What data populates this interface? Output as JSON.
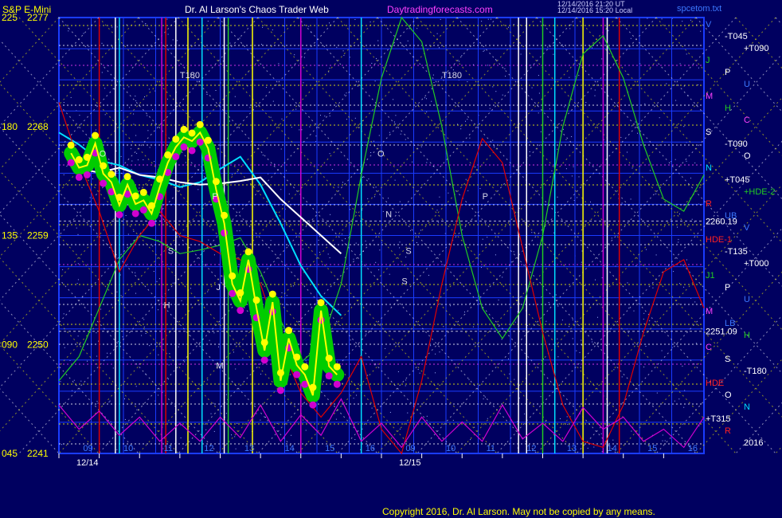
{
  "header": {
    "title_left": "S&P E-Mini",
    "title_center": "Dr. Al Larson's Chaos Trader Web",
    "site": "Daytradingforecasts.com",
    "info_line1": "12/14/2016 21:20 UT",
    "info_line2": "12/14/2016 15:20 Local",
    "file": "spcetom.txt"
  },
  "copyright": "Copyright 2016, Dr. Al Larson. May not be copied by any means.",
  "colors": {
    "background": "#000060",
    "grid_blue": "#1a3cff",
    "yellow": "#ffff00",
    "green_band": "#00cc00",
    "magenta": "#d000d0",
    "cyan": "#00e0ff",
    "white": "#ffffff",
    "red": "#e00000",
    "green_line": "#22cc22"
  },
  "chart_data": {
    "type": "line",
    "y_axis_labels": [
      {
        "angle": "225",
        "price": 2277
      },
      {
        "angle": "180",
        "price": 2268
      },
      {
        "angle": "135",
        "price": 2259
      },
      {
        "angle": "090",
        "price": 2250
      },
      {
        "angle": "045",
        "price": 2241
      }
    ],
    "ylim": [
      2241,
      2277
    ],
    "x_hours": [
      "09",
      "10",
      "11",
      "12",
      "13",
      "14",
      "15",
      "16",
      "09",
      "10",
      "11",
      "12",
      "13",
      "14",
      "15",
      "16"
    ],
    "x_dates": [
      "12/14",
      "12/15"
    ],
    "price_levels": [
      {
        "label": "2260.19",
        "price": 2260.19
      },
      {
        "label": "2251.09",
        "price": 2251.09
      }
    ],
    "right_labels": [
      {
        "text": "V",
        "color": "#3c78ff"
      },
      {
        "text": "-T045",
        "color": "#ffffff"
      },
      {
        "text": "+T090",
        "color": "#ffffff"
      },
      {
        "text": "J",
        "color": "#22cc22"
      },
      {
        "text": "P",
        "color": "#ffffff"
      },
      {
        "text": "U",
        "color": "#3c78ff"
      },
      {
        "text": "M",
        "color": "#ff40ff"
      },
      {
        "text": "H",
        "color": "#22cc22"
      },
      {
        "text": "C",
        "color": "#ff40ff"
      },
      {
        "text": "S",
        "color": "#ffffff"
      },
      {
        "text": "-T090",
        "color": "#ffffff"
      },
      {
        "text": "O",
        "color": "#ffffff"
      },
      {
        "text": "N",
        "color": "#00e0ff"
      },
      {
        "text": "+T045",
        "color": "#ffffff"
      },
      {
        "text": "+HDE-2",
        "color": "#22cc22"
      },
      {
        "text": "R",
        "color": "#ff2020"
      },
      {
        "text": "UB",
        "color": "#3c78ff"
      },
      {
        "text": "V",
        "color": "#3c78ff"
      },
      {
        "text": "HDE-1",
        "color": "#ff2020"
      },
      {
        "text": "-T135",
        "color": "#ffffff"
      },
      {
        "text": "+T000",
        "color": "#ffffff"
      },
      {
        "text": "J1",
        "color": "#22cc22"
      },
      {
        "text": "P",
        "color": "#ffffff"
      },
      {
        "text": "U",
        "color": "#3c78ff"
      },
      {
        "text": "M",
        "color": "#ff40ff"
      },
      {
        "text": "LB",
        "color": "#3c78ff"
      },
      {
        "text": "H",
        "color": "#22cc22"
      },
      {
        "text": "C",
        "color": "#ff40ff"
      },
      {
        "text": "S",
        "color": "#ffffff"
      },
      {
        "text": "-T180",
        "color": "#ffffff"
      },
      {
        "text": "HDE",
        "color": "#ff2020"
      },
      {
        "text": "O",
        "color": "#ffffff"
      },
      {
        "text": "N",
        "color": "#00e0ff"
      },
      {
        "text": "+T315",
        "color": "#ffffff"
      },
      {
        "text": "R",
        "color": "#ff2020"
      },
      {
        "text": "2016",
        "color": "#ffffff"
      }
    ],
    "chart_labels": [
      "T180",
      "T180",
      "O",
      "P",
      "S",
      "O",
      "N",
      "S",
      "P",
      "H",
      "J",
      "S",
      "M"
    ],
    "series": [
      {
        "name": "price",
        "color": "#ffff00",
        "x": [
          0.3,
          0.5,
          0.7,
          0.9,
          1.1,
          1.3,
          1.5,
          1.7,
          1.9,
          2.1,
          2.3,
          2.5,
          2.7,
          2.9,
          3.1,
          3.3,
          3.5,
          3.7,
          3.9,
          4.1,
          4.3,
          4.5,
          4.7,
          4.9,
          5.1,
          5.3,
          5.5,
          5.7,
          5.9,
          6.1,
          6.3,
          6.5,
          6.7,
          6.9
        ],
        "y": [
          2265.8,
          2264.6,
          2264.8,
          2266.6,
          2264.1,
          2263.4,
          2261.5,
          2263.2,
          2261.6,
          2261.9,
          2260.8,
          2263.0,
          2265.0,
          2266.3,
          2267.1,
          2266.8,
          2267.5,
          2266.2,
          2262.8,
          2260.0,
          2255.0,
          2253.6,
          2257.0,
          2253.0,
          2249.5,
          2253.5,
          2247.0,
          2250.5,
          2248.3,
          2247.5,
          2245.8,
          2252.8,
          2248.2,
          2247.5
        ]
      },
      {
        "name": "cyan",
        "color": "#00e0ff",
        "x": [
          0.0,
          0.5,
          1.0,
          1.5,
          2.0,
          2.5,
          3.0,
          3.5,
          4.0,
          4.5,
          5.0,
          5.5,
          6.0,
          6.5,
          7.0
        ],
        "y": [
          2267.5,
          2266.5,
          2265.2,
          2264.8,
          2264.0,
          2263.6,
          2263.0,
          2263.4,
          2264.5,
          2265.5,
          2263.2,
          2260.0,
          2256.5,
          2254.0,
          2252.4
        ]
      },
      {
        "name": "white",
        "color": "#ffffff",
        "x": [
          0.5,
          1.0,
          1.5,
          2.0,
          2.5,
          3.0,
          3.5,
          4.0,
          4.5,
          5.0,
          5.5,
          6.0,
          6.5,
          7.0
        ],
        "y": [
          2264.5,
          2264.2,
          2264.6,
          2264.0,
          2263.8,
          2263.4,
          2263.2,
          2263.3,
          2263.5,
          2263.8,
          2262.0,
          2260.5,
          2259.0,
          2257.5
        ]
      },
      {
        "name": "green",
        "color": "#22cc22",
        "x": [
          0.0,
          0.5,
          1.0,
          1.5,
          2.0,
          2.5,
          3.0,
          3.5,
          4.0,
          4.5,
          5.0,
          5.5,
          6.0,
          6.5,
          7.0,
          7.5,
          8.0,
          8.5,
          9.0,
          9.5,
          10.0,
          10.5,
          11.0,
          11.5,
          12.0,
          12.5,
          13.0,
          13.5,
          14.0,
          14.5,
          15.0,
          15.5,
          16.0
        ],
        "y": [
          2247,
          2249,
          2253,
          2257,
          2259,
          2258.5,
          2257.5,
          2257.8,
          2258.2,
          2258.8,
          2256,
          2252,
          2248.5,
          2250,
          2255,
          2264,
          2272,
          2277,
          2275,
          2268,
          2259,
          2253,
          2250.5,
          2253,
          2259,
          2268,
          2274,
          2275.5,
          2272,
          2266.5,
          2262,
          2261,
          2264
        ]
      },
      {
        "name": "red",
        "color": "#e00000",
        "x": [
          0.0,
          0.5,
          1.0,
          1.5,
          2.0,
          2.5,
          3.0,
          3.5,
          4.0,
          4.5,
          5.0,
          5.5,
          6.0,
          6.5,
          7.0,
          7.5,
          8.0,
          8.5,
          9.0,
          9.5,
          10.0,
          10.5,
          11.0,
          11.5,
          12.0,
          12.5,
          13.0,
          13.5,
          14.0,
          14.5,
          15.0,
          15.5,
          16.0
        ],
        "y": [
          2270,
          2265,
          2261,
          2256,
          2259,
          2261,
          2259,
          2258.5,
          2257.5,
          2257,
          2255,
          2250,
          2246,
          2244,
          2246,
          2249,
          2243,
          2241,
          2247,
          2255,
          2262,
          2267,
          2265,
          2258,
          2251,
          2245,
          2242,
          2241.5,
          2245,
          2251,
          2256,
          2257,
          2253
        ]
      },
      {
        "name": "magenta",
        "color": "#d000d0",
        "x": [
          0.0,
          0.5,
          1.0,
          1.5,
          2.0,
          2.5,
          3.0,
          3.5,
          4.0,
          4.5,
          5.0,
          5.5,
          6.0,
          6.5,
          7.0,
          7.5,
          8.0,
          8.5,
          9.0,
          9.5,
          10.0,
          10.5,
          11.0,
          11.5,
          12.0,
          12.5,
          13.0,
          13.5,
          14.0,
          14.5,
          15.0,
          15.5,
          16.0
        ],
        "y": [
          2245,
          2243,
          2244.5,
          2242.5,
          2244,
          2242,
          2243.5,
          2242,
          2244,
          2242.3,
          2245,
          2242,
          2244.2,
          2242.5,
          2245.5,
          2242,
          2243.5,
          2241.5,
          2244,
          2242,
          2243.6,
          2242,
          2245,
          2242.2,
          2243.5,
          2242,
          2244.8,
          2243,
          2244,
          2242,
          2243,
          2241.5,
          2244
        ]
      }
    ],
    "cycle_lines": [
      {
        "color": "#00e0ff",
        "x": [
          1.5,
          3.55,
          7.5,
          12.3
        ]
      },
      {
        "color": "#ffffff",
        "x": [
          1.4,
          2.9,
          4.1,
          11.4,
          11.6,
          13.6
        ]
      },
      {
        "color": "#d000d0",
        "x": [
          2.55,
          6.0,
          13.5
        ]
      },
      {
        "color": "#ffff00",
        "x": [
          3.2,
          4.8,
          13.0
        ]
      },
      {
        "color": "#e00000",
        "x": [
          1.0,
          2.65,
          13.9
        ]
      },
      {
        "color": "#22cc22",
        "x": [
          4.2,
          12.0
        ]
      }
    ]
  }
}
